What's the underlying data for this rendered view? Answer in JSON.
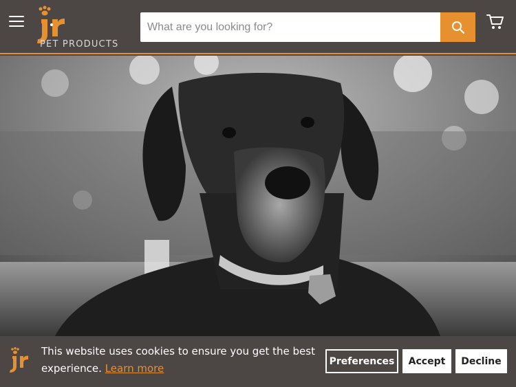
{
  "header": {
    "menu_icon": "hamburger-menu-icon",
    "logo_text": "jr",
    "logo_subtext": "PET PRODUCTS",
    "search": {
      "placeholder": "What are you looking for?",
      "value": ""
    },
    "search_icon": "search-icon",
    "cart_icon": "cart-icon"
  },
  "hero": {
    "image": "black-and-white-photo-of-great-dane-dog"
  },
  "cookie_banner": {
    "message": "This website uses cookies to ensure you get the best experience.",
    "learn_more": "Learn more",
    "preferences_label": "Preferences",
    "accept_label": "Accept",
    "decline_label": "Decline"
  },
  "colors": {
    "header_bg": "#4c4645",
    "accent": "#e7902f",
    "white": "#ffffff"
  }
}
